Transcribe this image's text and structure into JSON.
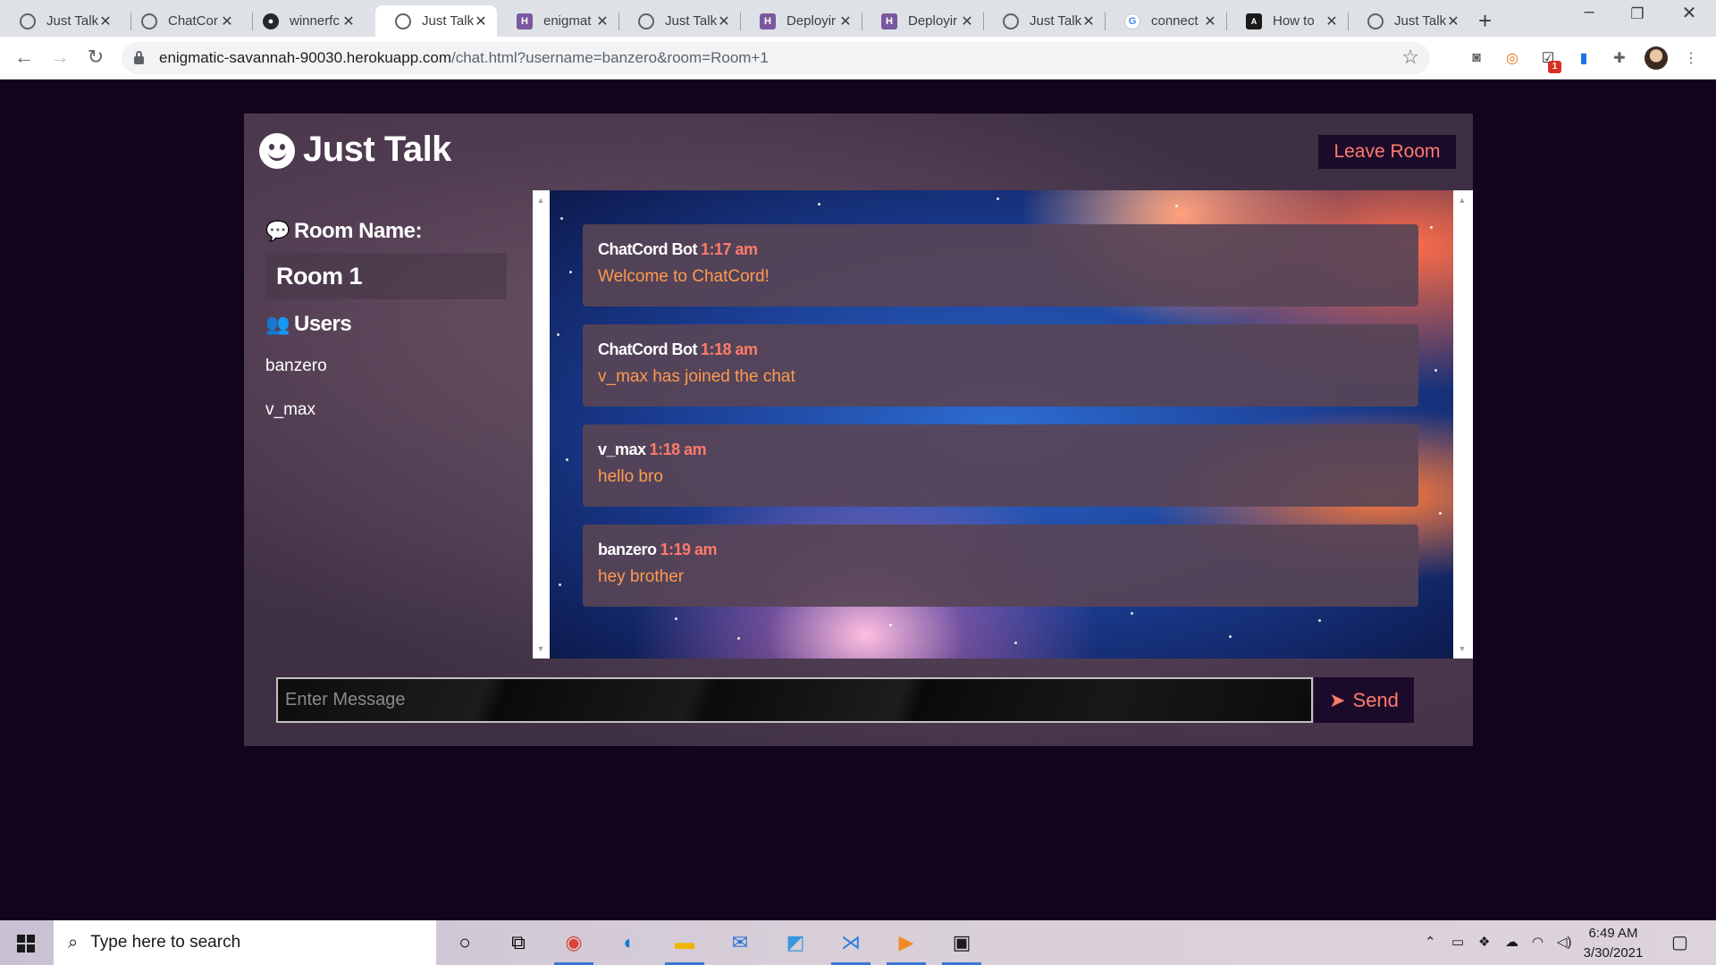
{
  "browser": {
    "tabs": [
      {
        "title": "Just Talk",
        "icon": "globe-icon",
        "active": false
      },
      {
        "title": "ChatCor",
        "icon": "globe-icon",
        "active": false
      },
      {
        "title": "winnerfc",
        "icon": "github-icon",
        "active": false
      },
      {
        "title": "Just Talk",
        "icon": "globe-icon",
        "active": true
      },
      {
        "title": "enigmat",
        "icon": "heroku-icon",
        "active": false
      },
      {
        "title": "Just Talk",
        "icon": "globe-icon",
        "active": false
      },
      {
        "title": "Deployir",
        "icon": "heroku-icon",
        "active": false
      },
      {
        "title": "Deployir",
        "icon": "heroku-icon",
        "active": false
      },
      {
        "title": "Just Talk",
        "icon": "globe-icon",
        "active": false
      },
      {
        "title": "connect",
        "icon": "google-icon",
        "active": false
      },
      {
        "title": "How to",
        "icon": "dev-icon",
        "active": false
      },
      {
        "title": "Just Talk",
        "icon": "globe-icon",
        "active": false
      }
    ],
    "url_host": "enigmatic-savannah-90030.herokuapp.com",
    "url_path": "/chat.html?username=banzero&room=Room+1",
    "extension_badge": "1"
  },
  "app": {
    "title": "Just Talk",
    "leave_button": "Leave Room",
    "room_heading": "Room Name:",
    "room_name": "Room 1",
    "users_heading": "Users",
    "users": [
      "banzero",
      "v_max"
    ],
    "messages": [
      {
        "user": "ChatCord Bot",
        "time": "1:17 am",
        "text": "Welcome to ChatCord!"
      },
      {
        "user": "ChatCord Bot",
        "time": "1:18 am",
        "text": "v_max has joined the chat"
      },
      {
        "user": "v_max",
        "time": "1:18 am",
        "text": "hello bro"
      },
      {
        "user": "banzero",
        "time": "1:19 am",
        "text": "hey brother"
      }
    ],
    "input_placeholder": "Enter Message",
    "send_button": "Send"
  },
  "taskbar": {
    "search_placeholder": "Type here to search",
    "time": "6:49 AM",
    "date": "3/30/2021"
  },
  "colors": {
    "accent": "#ff7b6a",
    "message_text": "#ff9a4e",
    "button_bg": "#1b0a2a",
    "page_bg": "#13041d"
  }
}
